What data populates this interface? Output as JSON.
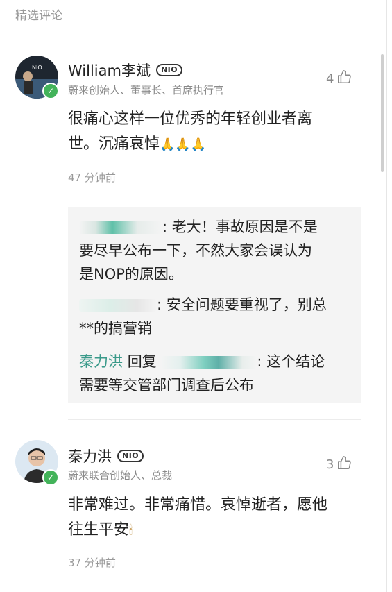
{
  "header": {
    "title": "精选评论"
  },
  "comments": [
    {
      "name": "William李斌",
      "badge": "NIO",
      "role": "蔚来创始人、董事长、首席执行官",
      "likes": "4",
      "text_line1": "很痛心这样一位优秀的年轻创业者离",
      "text_line2": "世。沉痛哀悼",
      "emoji": "🙏🙏🙏",
      "time": "47 分钟前",
      "replies": [
        {
          "text_line1": ": 老大！事故原因是不是",
          "text_line2": "要尽早公布一下，不然大家会误认为",
          "text_line3": "是NOP的原因。"
        },
        {
          "text_line1": ": 安全问题要重视了，别总",
          "text_line2": "**的搞营销"
        },
        {
          "author": "秦力洪",
          "reply_word": "回复",
          "text_line1": ": 这个结论",
          "text_line2": "需要等交管部门调查后公布"
        }
      ]
    },
    {
      "name": "秦力洪",
      "badge": "NIO",
      "role": "蔚来联合创始人、总裁",
      "likes": "3",
      "text_line1": "非常难过。非常痛惜。哀悼逝者，愿他",
      "text_line2": "往生平安",
      "emoji": "🕯",
      "time": "37 分钟前"
    }
  ],
  "icons": {
    "like": "thumbs-up-icon",
    "verified": "verified-check-icon",
    "badge": "nio-badge-icon"
  },
  "colors": {
    "highlight": "#3a9a8a",
    "verified": "#43b35a"
  }
}
